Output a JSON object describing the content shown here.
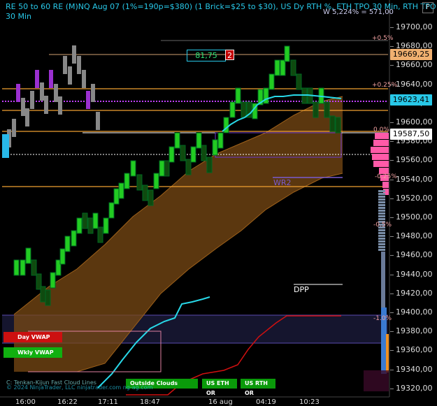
{
  "header": {
    "title_line1": "RE 50 to 60 RE (M)NQ Aug 07 (1%=190p=$380) (1 Brick=$25 to $30), US Dy RTH %, ETH TPO 30 Min, RTH TPO",
    "title_line2": "30 Min",
    "right_info": "W 5,224% = 571,00"
  },
  "window": {
    "float_button": "F"
  },
  "y_axis": {
    "ticks": [
      "19700,00",
      "19680,00",
      "19660,00",
      "19640,00",
      "19620,00",
      "19600,00",
      "19580,00",
      "19560,00",
      "19540,00",
      "19520,00",
      "19500,00",
      "19480,00",
      "19460,00",
      "19440,00",
      "19420,00",
      "19400,00",
      "19380,00",
      "19360,00",
      "19340,00",
      "19320,00"
    ],
    "price_labels": [
      {
        "value": "19669,25",
        "bg": "#f0b070",
        "fg": "#000"
      },
      {
        "value": "19623,41",
        "bg": "#28c8e8",
        "fg": "#000"
      },
      {
        "value": "19587,50",
        "bg": "#ffffff",
        "fg": "#000"
      }
    ]
  },
  "x_axis": {
    "ticks": [
      "16:00",
      "16:22",
      "17:11",
      "18:47",
      "16 aug",
      "04:19",
      "10:23"
    ]
  },
  "percent_levels": [
    {
      "label": "+0.5%",
      "color": "#f0a0a0"
    },
    {
      "label": "+0.25%",
      "color": "#f0a0a0"
    },
    {
      "label": "0.0%",
      "color": "#f0a0a0"
    },
    {
      "label": "-0.25%",
      "color": "#f0a0a0"
    },
    {
      "label": "-0.5%",
      "color": "#f0a0a0"
    },
    {
      "label": "-1.0%",
      "color": "#f0a0a0"
    }
  ],
  "annotations": {
    "wr2": "WR2",
    "dpp": "DPP",
    "range_value": "81,75",
    "range_count": "2"
  },
  "buttons": {
    "day_vwap": "Day VWAP",
    "wkly_vwap": "Wkly VWAP",
    "outside_clouds": "Outside Clouds",
    "us_eth_or": "US ETH OR",
    "us_rth_or": "US RTH OR"
  },
  "footer": {
    "line1": "C: Tenkan-Kijun Fast Cloud Lines",
    "line2": "© 2024 NinjaTrader, LLC  ninjatrader.com  ng-ag.com"
  },
  "colors": {
    "bull": "#22cc22",
    "bear": "#0f4a0f",
    "cloud": "#7a4a14",
    "vwap_cyan": "#28d8e8",
    "level_orange": "#f0a030",
    "magenta": "#c040ff",
    "profile_pink": "#ff5aa8"
  }
}
